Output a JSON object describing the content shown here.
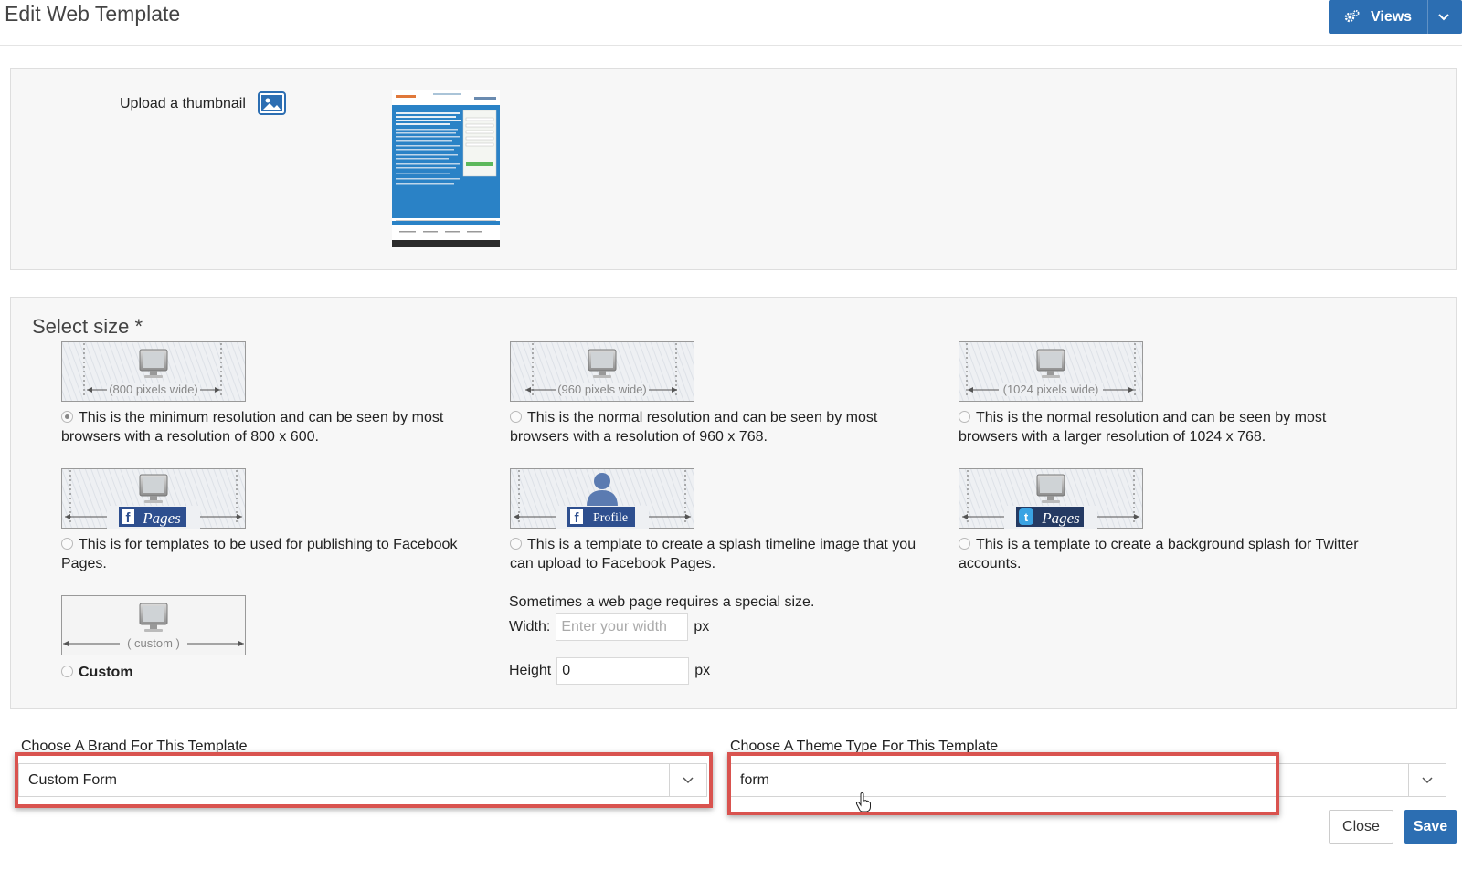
{
  "header": {
    "title": "Edit Web Template",
    "views_label": "Views",
    "views_icon": "gears-icon",
    "caret_icon": "chevron-down-icon"
  },
  "thumbnail": {
    "upload_label": "Upload a thumbnail",
    "upload_icon": "image-icon"
  },
  "size": {
    "title": "Select size *",
    "options": [
      {
        "image_label": "(800 pixels wide)",
        "text": "This is the minimum resolution and can be seen by most browsers with a resolution of 800 x 600.",
        "checked": true
      },
      {
        "image_label": "(960 pixels wide)",
        "text": "This is the normal resolution and can be seen by most browsers with a resolution of 960 x 768.",
        "checked": false
      },
      {
        "image_label": "(1024 pixels wide)",
        "text": "This is the normal resolution and can be seen by most browsers with a larger resolution of 1024 x 768.",
        "checked": false
      },
      {
        "image_label": "Pages",
        "text": "This is for templates to be used for publishing to Facebook Pages.",
        "checked": false
      },
      {
        "image_label": "Profile",
        "text": "This is a template to create a splash timeline image that you can upload to Facebook Pages.",
        "checked": false
      },
      {
        "image_label": "Pages",
        "text": "This is a template to create a background splash for Twitter accounts.",
        "checked": false
      },
      {
        "image_label": "( custom )",
        "text": "Custom",
        "checked": false
      }
    ],
    "custom": {
      "note": "Sometimes a web page requires a special size.",
      "width_label": "Width:",
      "width_placeholder": "Enter your width",
      "width_value": "",
      "height_label": "Height",
      "height_value": "0",
      "unit": "px"
    }
  },
  "brand": {
    "label": "Choose A Brand For This Template",
    "value": "Custom Form"
  },
  "theme": {
    "label": "Choose A Theme Type For This Template",
    "value": "form"
  },
  "footer": {
    "close_label": "Close",
    "save_label": "Save"
  },
  "colors": {
    "primary": "#2c6eb2",
    "highlight": "#d9534f",
    "facebook": "#2e4f8f"
  }
}
